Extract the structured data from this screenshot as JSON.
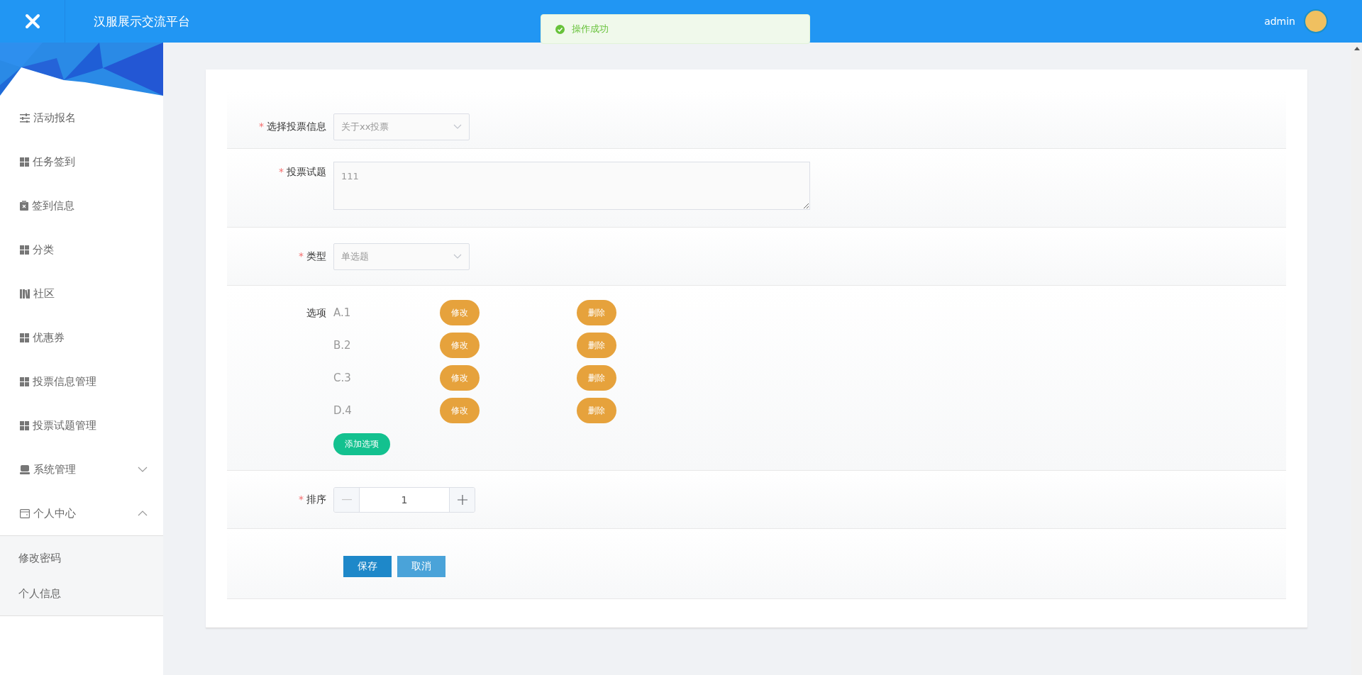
{
  "header": {
    "title": "汉服展示交流平台",
    "user": "admin"
  },
  "toast": {
    "message": "操作成功"
  },
  "sidebar": {
    "items": [
      {
        "label": "活动报名"
      },
      {
        "label": "任务签到"
      },
      {
        "label": "签到信息"
      },
      {
        "label": "分类"
      },
      {
        "label": "社区"
      },
      {
        "label": "优惠券"
      },
      {
        "label": "投票信息管理"
      },
      {
        "label": "投票试题管理"
      },
      {
        "label": "系统管理",
        "expanded": false
      },
      {
        "label": "个人中心",
        "expanded": true,
        "children": [
          {
            "label": "修改密码"
          },
          {
            "label": "个人信息"
          }
        ]
      }
    ]
  },
  "form": {
    "vote_info": {
      "label": "选择投票信息",
      "required_mark": "*",
      "value": "关于xx投票"
    },
    "question": {
      "label": "投票试题",
      "required_mark": "*",
      "value": "111"
    },
    "type": {
      "label": "类型",
      "required_mark": "*",
      "value": "单选题"
    },
    "options": {
      "label": "选项",
      "items": [
        {
          "text": "A.1",
          "edit": "修改",
          "delete": "删除"
        },
        {
          "text": "B.2",
          "edit": "修改",
          "delete": "删除"
        },
        {
          "text": "C.3",
          "edit": "修改",
          "delete": "删除"
        },
        {
          "text": "D.4",
          "edit": "修改",
          "delete": "删除"
        }
      ],
      "add": "添加选项"
    },
    "order": {
      "label": "排序",
      "required_mark": "*",
      "value": "1",
      "decrement_disabled": true
    },
    "buttons": {
      "save": "保存",
      "cancel": "取消"
    }
  }
}
